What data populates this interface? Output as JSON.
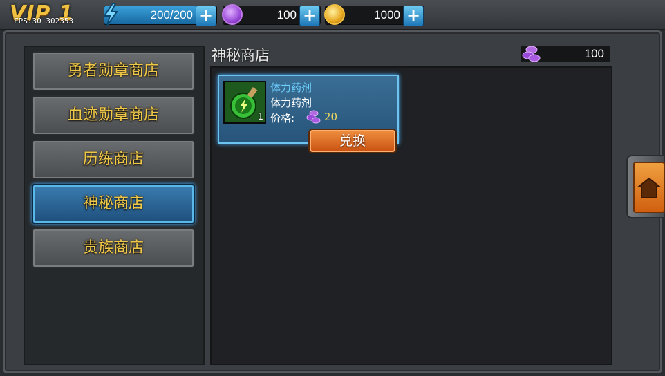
{
  "vip": {
    "label": "VIP 1",
    "fps": "FPS:30 302353"
  },
  "resources": {
    "energy": "200/200",
    "gems": "100",
    "gold": "1000"
  },
  "store": {
    "title": "神秘商店",
    "balance": "100"
  },
  "tabs": [
    {
      "label": "勇者勋章商店"
    },
    {
      "label": "血迹勋章商店"
    },
    {
      "label": "历练商店"
    },
    {
      "label": "神秘商店",
      "active": true
    },
    {
      "label": "贵族商店"
    }
  ],
  "item": {
    "name": "体力药剂",
    "desc": "体力药剂",
    "price_label": "价格:",
    "price": "20",
    "qty": "1",
    "button": "兑换"
  }
}
